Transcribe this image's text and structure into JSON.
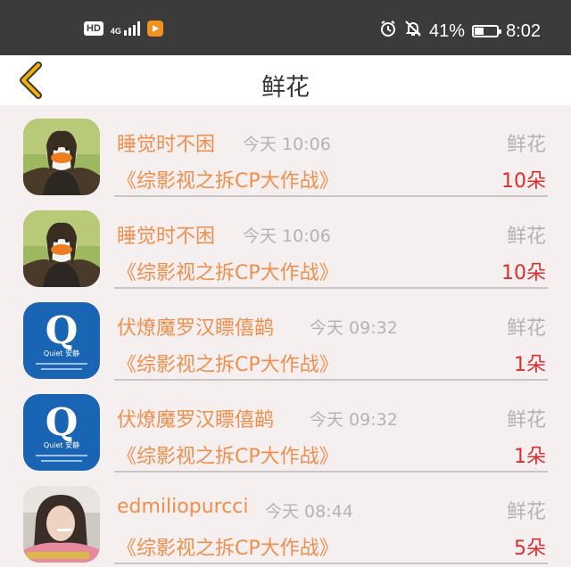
{
  "status_bar": {
    "hd": "HD",
    "network": "4G",
    "battery_percent": "41%",
    "battery_level": 0.41,
    "time": "8:02",
    "icons": [
      "hd-badge-icon",
      "signal-icon",
      "app-notification-icon",
      "alarm-icon",
      "mute-icon",
      "battery-icon"
    ]
  },
  "header": {
    "title": "鲜花",
    "back_icon": "chevron-left-icon",
    "accent_color": "#f2b300"
  },
  "colors": {
    "name": "#ee8f4e",
    "count": "#d8302e",
    "muted": "#b6b2b2",
    "list_bg": "#f5efef"
  },
  "rows": [
    {
      "avatar": "duck-mona-lisa-avatar",
      "name": "睡觉时不困",
      "time": "今天 10:06",
      "tag": "鲜花",
      "work": "《综影视之拆CP大作战》",
      "count": "10朵"
    },
    {
      "avatar": "duck-mona-lisa-avatar",
      "name": "睡觉时不困",
      "time": "今天 10:06",
      "tag": "鲜花",
      "work": "《综影视之拆CP大作战》",
      "count": "10朵"
    },
    {
      "avatar": "quiet-logo-avatar",
      "name": "伏燎魔罗汉瞟僖鹋",
      "time": "今天 09:32",
      "tag": "鲜花",
      "work": "《综影视之拆CP大作战》",
      "count": "1朵"
    },
    {
      "avatar": "quiet-logo-avatar",
      "name": "伏燎魔罗汉瞟僖鹋",
      "time": "今天 09:32",
      "tag": "鲜花",
      "work": "《综影视之拆CP大作战》",
      "count": "1朵"
    },
    {
      "avatar": "girl-photo-avatar",
      "name": "edmiliopurcci",
      "time": "今天 08:44",
      "tag": "鲜花",
      "work": "《综影视之拆CP大作战》",
      "count": "5朵"
    }
  ],
  "avatar_text": {
    "quiet_letter": "Q",
    "quiet_label": "Quiet 安静"
  }
}
